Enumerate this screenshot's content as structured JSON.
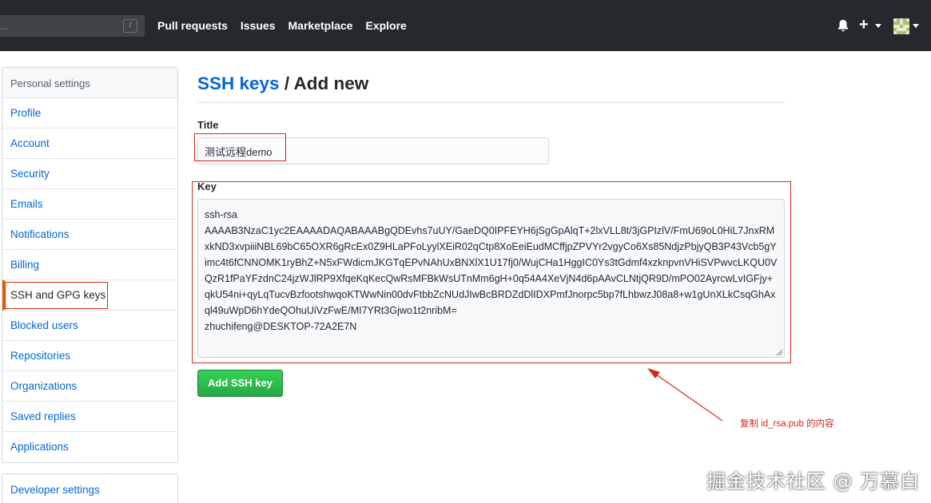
{
  "header": {
    "search_placeholder": "...",
    "search_shortcut": "/",
    "nav": [
      "Pull requests",
      "Issues",
      "Marketplace",
      "Explore"
    ],
    "icons": {
      "notifications": "bell-icon",
      "create": "plus-icon",
      "avatar": "user-avatar"
    }
  },
  "sidebar": {
    "header": "Personal settings",
    "items": [
      {
        "label": "Profile"
      },
      {
        "label": "Account"
      },
      {
        "label": "Security"
      },
      {
        "label": "Emails"
      },
      {
        "label": "Notifications"
      },
      {
        "label": "Billing"
      },
      {
        "label": "SSH and GPG keys",
        "selected": true
      },
      {
        "label": "Blocked users"
      },
      {
        "label": "Repositories"
      },
      {
        "label": "Organizations"
      },
      {
        "label": "Saved replies"
      },
      {
        "label": "Applications"
      }
    ],
    "developer": "Developer settings"
  },
  "main": {
    "breadcrumb_link": "SSH keys",
    "breadcrumb_sep": " / ",
    "breadcrumb_current": "Add new",
    "title_label": "Title",
    "title_value": "测试远程demo",
    "key_label": "Key",
    "key_value": "ssh-rsa\nAAAAB3NzaC1yc2EAAAADAQABAAABgQDEvhs7uUY/GaeDQ0IPFEYH6jSgGpAlqT+2lxVLL8t/3jGPIzlV/FmU69oL0HiL7JnxRMxkND3xvpiiiNBL69bC65OXR6gRcEx0Z9HLaPFoLyylXEiR02qCtp8XoEeiEudMCffjpZPVYr2vgyCo6Xs85NdjzPbjyQB3P43Vcb5gYimc4t6fCNNOMK1ryBhZ+N5xFWdicmJKGTqEPvNAhUxBNXlX1U17fj0/WujCHa1HggIC0Ys3tGdmf4xzknpvnVHiSVPwvcLKQU0VQzR1fPaYFzdnC24jzWJlRP9XfqeKqKecQwRsMFBkWsUTnMm6gH+0q54A4XeVjN4d6pAAvCLNtjQR9D/mPO02AyrcwLvIGFjy+qkU54ni+qyLqTucvBzfootshwqoKTWwNin00dvFtbbZcNUdJIwBcBRDZdDlIDXPmfJnorpc5bp7fLhbwzJ08a8+w1gUnXLkCsqGhAxql49uWpD6hYdeQOhuUiVzFwE/MI7YRt3Gjwo1t2nribM=\nzhuchifeng@DESKTOP-72A2E7N",
    "submit_label": "Add SSH key"
  },
  "annotation": {
    "note": "复制 id_rsa.pub 的内容",
    "color": "#cf2a1b"
  },
  "watermark": "掘金技术社区 @ 万慕白"
}
